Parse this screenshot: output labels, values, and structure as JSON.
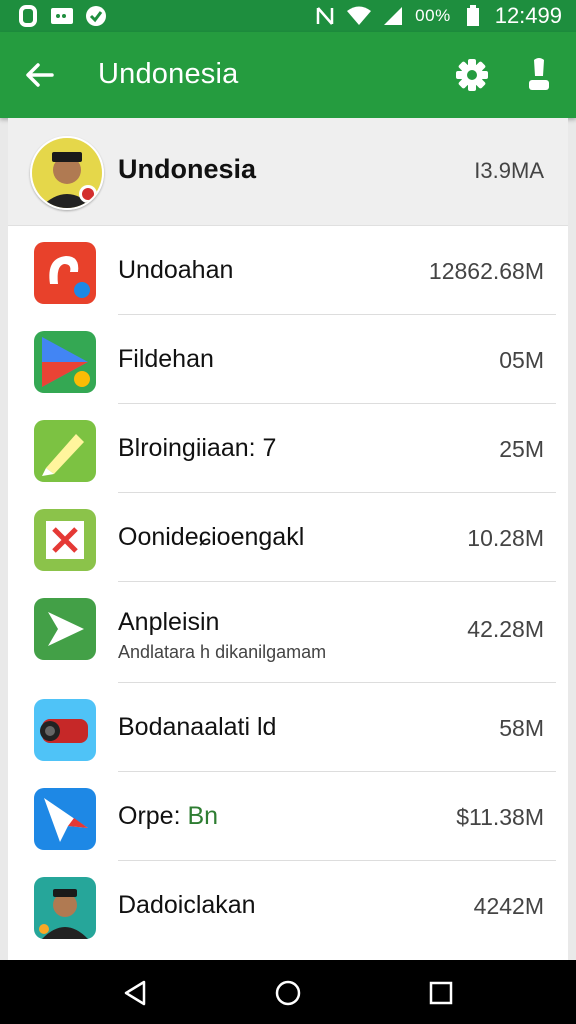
{
  "status_bar": {
    "battery_percent": "00%",
    "time": "12:499",
    "icons": [
      "notification-icon",
      "message-icon",
      "check-icon",
      "nfc-icon",
      "wifi-icon",
      "signal-icon",
      "battery-icon"
    ]
  },
  "app_bar": {
    "title": "Undonesia",
    "icons": [
      "back-arrow-icon",
      "settings-icon",
      "profile-icon"
    ]
  },
  "header": {
    "name": "Undonesia",
    "size": "I3.9MA"
  },
  "items": [
    {
      "name": "Undoahan",
      "size": "12862.68M",
      "icon": "red-app-icon",
      "color": "#e8412b"
    },
    {
      "name": "Fildehan",
      "size": "05M",
      "icon": "play-store-icon",
      "color": "#34a853"
    },
    {
      "name": "Blroingiiaan: 7",
      "size": "25M",
      "icon": "pencil-app-icon",
      "color": "#7cc242"
    },
    {
      "name": "Oonideɕioengakl",
      "size": "10.28M",
      "icon": "green-x-app-icon",
      "color": "#8bc34a"
    },
    {
      "name": "Anpleisin",
      "sub": "Andlatara h dikanilgamam",
      "size": "42.28M",
      "icon": "green-arrow-app-icon",
      "color": "#43a047"
    },
    {
      "name": "Bodanaalati ld",
      "size": "58M",
      "icon": "speaker-app-icon",
      "color": "#4fc3f7"
    },
    {
      "name": "Orpe:",
      "name_accent": "Bn",
      "size": "$11.38M",
      "icon": "paper-plane-app-icon",
      "color": "#1e88e5"
    },
    {
      "name": "Dadoiclakan",
      "size": "4242M",
      "icon": "person-app-icon",
      "color": "#26a69a"
    }
  ],
  "nav_bar": {
    "icons": [
      "nav-back-icon",
      "nav-home-icon",
      "nav-recents-icon"
    ]
  }
}
